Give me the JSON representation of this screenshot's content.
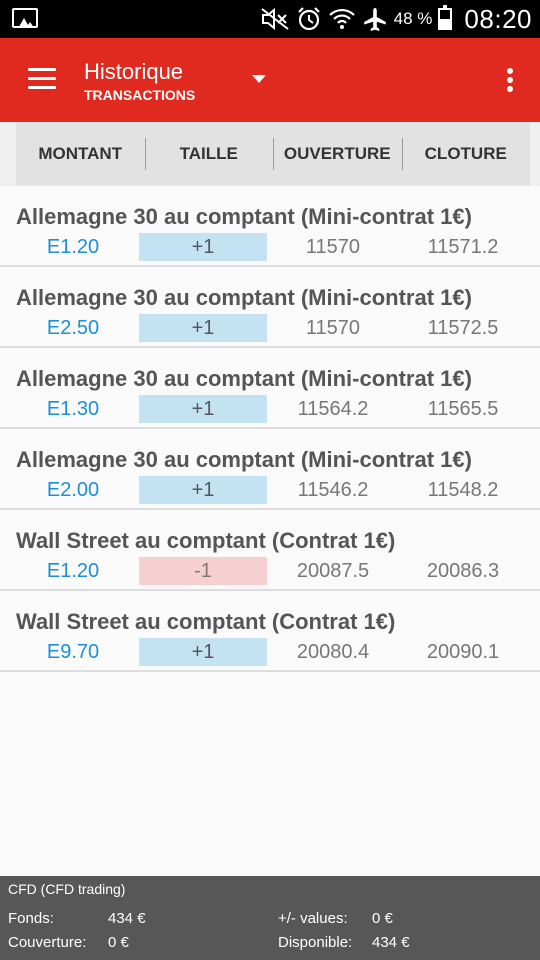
{
  "status_bar": {
    "battery_percent": "48 %",
    "time": "08:20",
    "icons": [
      "gallery-icon",
      "mute-icon",
      "alarm-icon",
      "wifi-icon",
      "airplane-icon",
      "battery-icon"
    ]
  },
  "app_bar": {
    "title": "Historique",
    "subtitle": "TRANSACTIONS",
    "color": "#e02a1f",
    "icons": [
      "menu-icon",
      "dropdown-icon",
      "overflow-menu-icon"
    ]
  },
  "table": {
    "columns": [
      "MONTANT",
      "TAILLE",
      "OUVERTURE",
      "CLOTURE"
    ],
    "rows": [
      {
        "name": "Allemagne 30 au comptant (Mini-contrat 1€)",
        "amount": "E1.20",
        "size": "+1",
        "size_sign": "positive",
        "open": "11570",
        "close": "11571.2"
      },
      {
        "name": "Allemagne 30 au comptant (Mini-contrat 1€)",
        "amount": "E2.50",
        "size": "+1",
        "size_sign": "positive",
        "open": "11570",
        "close": "11572.5"
      },
      {
        "name": "Allemagne 30 au comptant (Mini-contrat 1€)",
        "amount": "E1.30",
        "size": "+1",
        "size_sign": "positive",
        "open": "11564.2",
        "close": "11565.5"
      },
      {
        "name": "Allemagne 30 au comptant (Mini-contrat 1€)",
        "amount": "E2.00",
        "size": "+1",
        "size_sign": "positive",
        "open": "11546.2",
        "close": "11548.2"
      },
      {
        "name": "Wall Street au comptant (Contrat 1€)",
        "amount": "E1.20",
        "size": "-1",
        "size_sign": "negative",
        "open": "20087.5",
        "close": "20086.3"
      },
      {
        "name": "Wall Street au comptant (Contrat 1€)",
        "amount": "E9.70",
        "size": "+1",
        "size_sign": "positive",
        "open": "20080.4",
        "close": "20090.1"
      }
    ]
  },
  "footer": {
    "account": "CFD (CFD trading)",
    "fonds_label": "Fonds:",
    "fonds_value": "434 €",
    "couverture_label": "Couverture:",
    "couverture_value": "0 €",
    "pm_label": "+/- values:",
    "pm_value": "0 €",
    "disponible_label": "Disponible:",
    "disponible_value": "434 €"
  }
}
